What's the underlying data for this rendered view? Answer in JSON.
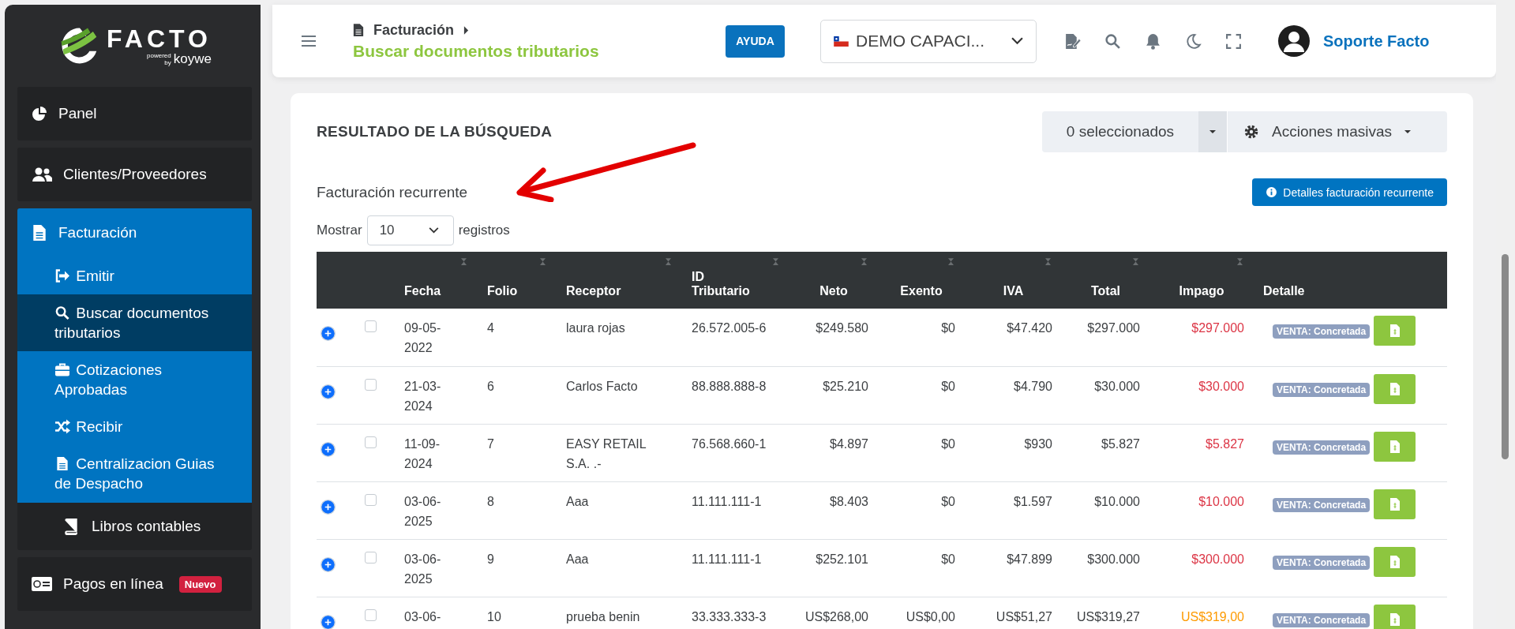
{
  "sidebar": {
    "logo": {
      "name": "FACTO",
      "powered": "powered",
      "by": "by",
      "brand": "koywe"
    },
    "items": [
      {
        "label": "Panel",
        "kind": "item",
        "selected": false
      },
      {
        "label": "Clientes/Proveedores",
        "kind": "item",
        "selected": false
      },
      {
        "label": "Facturación",
        "kind": "group",
        "children": [
          {
            "label": "Emitir",
            "selected": false
          },
          {
            "label": "Buscar documentos tributarios",
            "selected": true
          },
          {
            "label": "Cotizaciones Aprobadas",
            "selected": false
          },
          {
            "label": "Recibir",
            "selected": false
          },
          {
            "label": "Centralizacion Guias de Despacho",
            "selected": false
          }
        ]
      },
      {
        "label": "Libros contables",
        "kind": "sub",
        "selected": false
      },
      {
        "label": "Pagos en línea",
        "kind": "item",
        "selected": false,
        "badge": "Nuevo"
      }
    ]
  },
  "header": {
    "breadcrumb": "Facturación",
    "title": "Buscar documentos tributarios",
    "help_button": "AYUDA",
    "company_select": "DEMO CAPACI...",
    "user": "Soporte Facto"
  },
  "results": {
    "title": "RESULTADO DE LA BÚSQUEDA",
    "selection": "0 seleccionados",
    "bulk_actions": "Acciones masivas",
    "subtitle": "Facturación recurrente",
    "details_button": "Detalles facturación recurrente",
    "page_size": {
      "before": "Mostrar",
      "value": "10",
      "after": "registros"
    },
    "columns": [
      "Fecha",
      "Folio",
      "Receptor",
      "ID Tributario",
      "Neto",
      "Exento",
      "IVA",
      "Total",
      "Impago",
      "Detalle"
    ],
    "rows": [
      {
        "checked": false,
        "fecha": "09-05-2022",
        "folio": "4",
        "receptor": "laura rojas",
        "id": "26.572.005-6",
        "neto": "$249.580",
        "exento": "$0",
        "iva": "$47.420",
        "total": "$297.000",
        "impago": "$297.000",
        "color": "#dc3545",
        "status": "VENTA: Concretada"
      },
      {
        "checked": false,
        "fecha": "21-03-2024",
        "folio": "6",
        "receptor": "Carlos Facto",
        "id": "88.888.888-8",
        "neto": "$25.210",
        "exento": "$0",
        "iva": "$4.790",
        "total": "$30.000",
        "impago": "$30.000",
        "color": "#dc3545",
        "status": "VENTA: Concretada"
      },
      {
        "checked": false,
        "fecha": "11-09-2024",
        "folio": "7",
        "receptor": "EASY RETAIL S.A. .-",
        "id": "76.568.660-1",
        "neto": "$4.897",
        "exento": "$0",
        "iva": "$930",
        "total": "$5.827",
        "impago": "$5.827",
        "color": "#dc3545",
        "status": "VENTA: Concretada"
      },
      {
        "checked": false,
        "fecha": "03-06-2025",
        "folio": "8",
        "receptor": "Aaa",
        "id": "11.111.111-1",
        "neto": "$8.403",
        "exento": "$0",
        "iva": "$1.597",
        "total": "$10.000",
        "impago": "$10.000",
        "color": "#dc3545",
        "status": "VENTA: Concretada"
      },
      {
        "checked": false,
        "fecha": "03-06-2025",
        "folio": "9",
        "receptor": "Aaa",
        "id": "11.111.111-1",
        "neto": "$252.101",
        "exento": "$0",
        "iva": "$47.899",
        "total": "$300.000",
        "impago": "$300.000",
        "color": "#dc3545",
        "status": "VENTA: Concretada"
      },
      {
        "checked": false,
        "fecha": "03-06-",
        "folio": "10",
        "receptor": "prueba benin",
        "id": "33.333.333-3",
        "neto": "US$268,00",
        "exento": "US$0,00",
        "iva": "US$51,27",
        "total": "US$319,27",
        "impago": "US$319,00",
        "color": "#fd9a00",
        "status": "VENTA: Concretada"
      }
    ]
  }
}
